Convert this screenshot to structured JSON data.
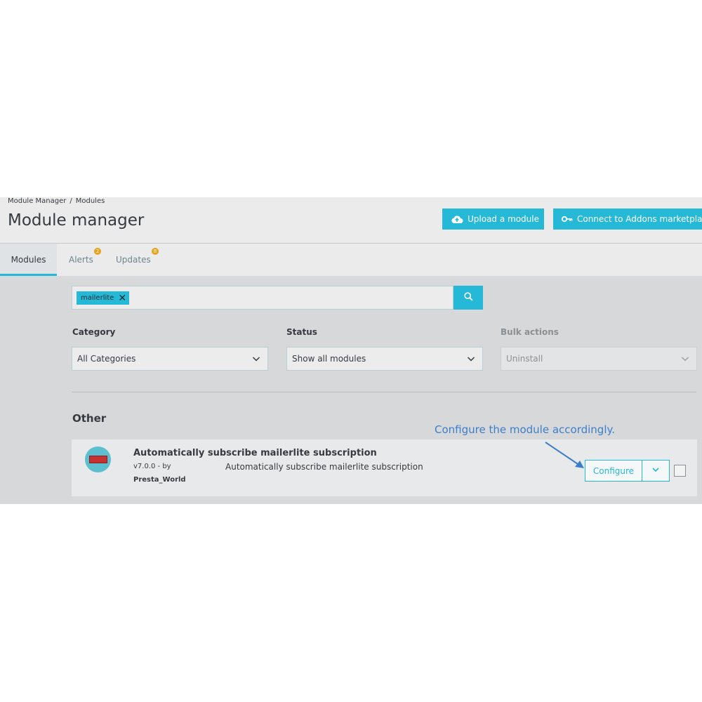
{
  "breadcrumb": {
    "items": [
      "Module Manager",
      "Modules"
    ],
    "separator": "/"
  },
  "header": {
    "title": "Module manager",
    "upload_label": "Upload a module",
    "connect_label": "Connect to Addons marketplace"
  },
  "tabs": [
    {
      "label": "Modules",
      "badge": ""
    },
    {
      "label": "Alerts",
      "badge": "2"
    },
    {
      "label": "Updates",
      "badge": "8"
    }
  ],
  "search": {
    "chip": "mailerlite"
  },
  "filters": {
    "category": {
      "label": "Category",
      "value": "All Categories"
    },
    "status": {
      "label": "Status",
      "value": "Show all modules"
    },
    "bulk": {
      "label": "Bulk actions",
      "value": "Uninstall"
    }
  },
  "section": {
    "title": "Other"
  },
  "annotation": {
    "text": "Configure the module accordingly."
  },
  "module": {
    "name": "Automatically subscribe mailerlite subscription",
    "version": "v7.0.0 - by",
    "author": "Presta_World",
    "description": "Automatically subscribe mailerlite subscription",
    "configure_label": "Configure"
  },
  "colors": {
    "accent": "#25b9d7",
    "badge": "#e7a21a",
    "annotation": "#3d7ec9"
  },
  "icons": [
    "cloud-upload-icon",
    "key-icon",
    "search-icon",
    "chevron-down-icon",
    "close-icon"
  ]
}
